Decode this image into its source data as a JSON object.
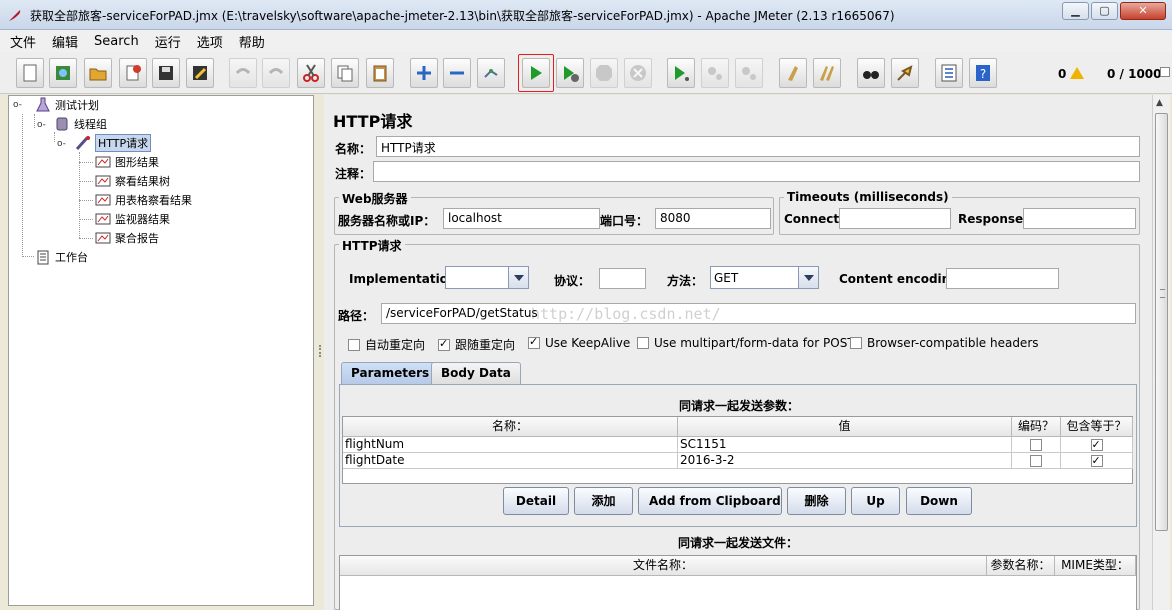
{
  "window": {
    "title": "获取全部旅客-serviceForPAD.jmx (E:\\travelsky\\software\\apache-jmeter-2.13\\bin\\获取全部旅客-serviceForPAD.jmx) - Apache JMeter (2.13 r1665067)",
    "minimize": "▁",
    "maximize": "▢",
    "close": "✕"
  },
  "menu": [
    "文件",
    "编辑",
    "Search",
    "运行",
    "选项",
    "帮助"
  ],
  "toolbar": {
    "warnings": "0",
    "threads": "0 / 1000"
  },
  "tree": {
    "nodes": [
      {
        "label": "测试计划",
        "icon": "flask-icon"
      },
      {
        "label": "线程组",
        "icon": "spool-icon"
      },
      {
        "label": "HTTP请求",
        "icon": "pipette-icon",
        "selected": true
      },
      {
        "label": "图形结果",
        "icon": "graph-listener-icon"
      },
      {
        "label": "察看结果树",
        "icon": "graph-listener-icon"
      },
      {
        "label": "用表格察看结果",
        "icon": "graph-listener-icon"
      },
      {
        "label": "监视器结果",
        "icon": "graph-listener-icon"
      },
      {
        "label": "聚合报告",
        "icon": "graph-listener-icon"
      },
      {
        "label": "工作台",
        "icon": "clipboard-icon"
      }
    ]
  },
  "sampler": {
    "heading": "HTTP请求",
    "name_label": "名称：",
    "name_value": "HTTP请求",
    "comment_label": "注释：",
    "comment_value": ""
  },
  "web_server": {
    "title": "Web服务器",
    "server_label": "服务器名称或IP：",
    "server_value": "localhost",
    "port_label": "端口号：",
    "port_value": "8080"
  },
  "timeouts": {
    "title": "Timeouts (milliseconds)",
    "connect_label": "Connect:",
    "connect_value": "",
    "response_label": "Response:",
    "response_value": ""
  },
  "http_request": {
    "title": "HTTP请求",
    "implementation_label": "Implementation:",
    "implementation_value": "",
    "protocol_label": "协议：",
    "protocol_value": "",
    "method_label": "方法：",
    "method_value": "GET",
    "encoding_label": "Content encoding:",
    "encoding_value": "",
    "path_label": "路径：",
    "path_value": "/serviceForPAD/getStatus",
    "options": [
      {
        "label": "自动重定向",
        "checked": false
      },
      {
        "label": "跟随重定向",
        "checked": true
      },
      {
        "label": "Use KeepAlive",
        "checked": true
      },
      {
        "label": "Use multipart/form-data for POST",
        "checked": false
      },
      {
        "label": "Browser-compatible headers",
        "checked": false
      }
    ]
  },
  "tabs": [
    "Parameters",
    "Body Data"
  ],
  "parameters": {
    "title": "同请求一起发送参数：",
    "columns": [
      "名称：",
      "值",
      "编码？",
      "包含等于？"
    ],
    "rows": [
      {
        "name": "flightNum",
        "value": "SC1151",
        "encode": false,
        "include_equals": true
      },
      {
        "name": "flightDate",
        "value": "2016-3-2",
        "encode": false,
        "include_equals": true
      }
    ],
    "buttons": [
      "Detail",
      "添加",
      "Add from Clipboard",
      "删除",
      "Up",
      "Down"
    ]
  },
  "files": {
    "title": "同请求一起发送文件：",
    "columns": [
      "文件名称：",
      "参数名称：",
      "MIME类型："
    ]
  },
  "watermark": "http://blog.csdn.net/"
}
